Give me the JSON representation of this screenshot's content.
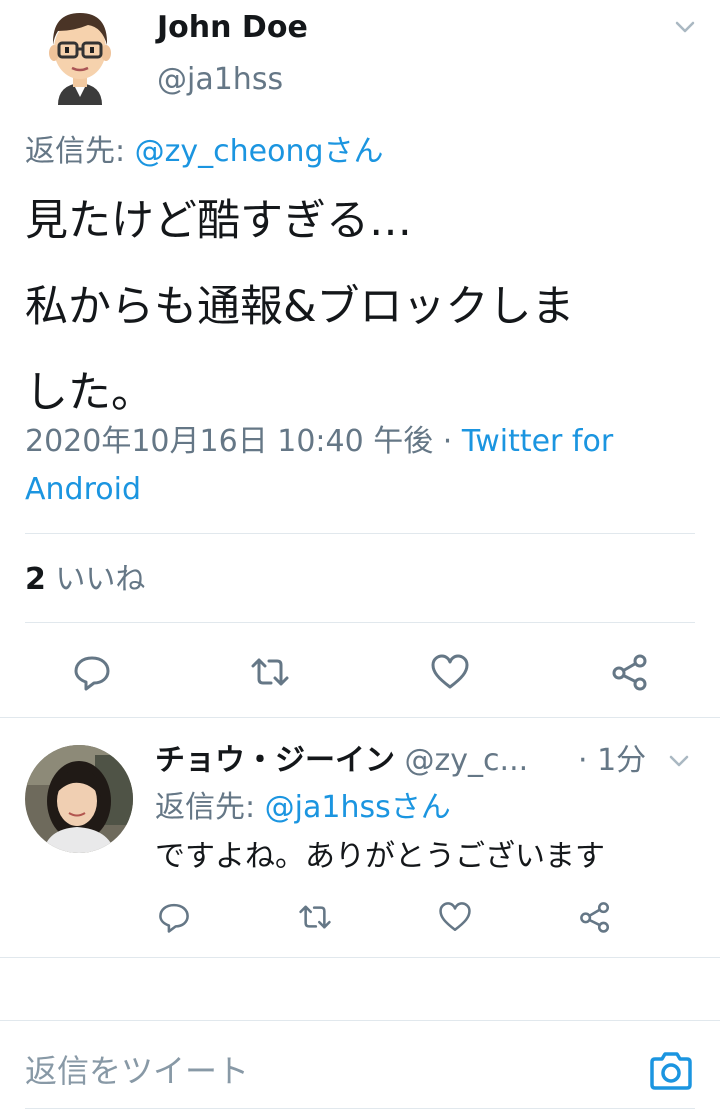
{
  "tweet": {
    "author_name": "John Doe",
    "author_handle": "@ja1hss",
    "reply_to_label": "返信先: ",
    "reply_to_user": "@zy_cheongさん",
    "text_line1": "見たけど酷すぎる…",
    "text_line2": "私からも通報&ブロックしま",
    "text_line3": "した。",
    "timestamp": "2020年10月16日 10:40 午後",
    "separator": " · ",
    "source_part1": "Twitter for",
    "source_part2": "Android",
    "likes_count": "2",
    "likes_label": "いいね",
    "actions": [
      "reply-icon",
      "retweet-icon",
      "like-icon",
      "share-icon"
    ]
  },
  "reply": {
    "author_name": "チョウ・ジーイン",
    "author_handle": "@zy_c...",
    "time": "· 1分",
    "reply_to_label": "返信先: ",
    "reply_to_user": "@ja1hssさん",
    "text": "ですよね。ありがとうございます"
  },
  "compose": {
    "placeholder": "返信をツイート",
    "camera_icon": "camera-icon"
  },
  "colors": {
    "link": "#1b95e0",
    "muted": "#657786",
    "divider": "#e1e8ed",
    "text": "#14171a"
  }
}
